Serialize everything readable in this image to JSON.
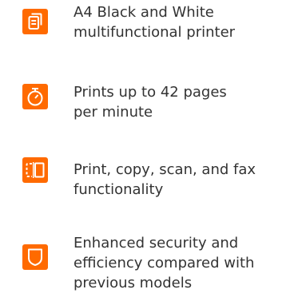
{
  "theme": {
    "accent": "#ff6a00",
    "text": "#333333",
    "background": "#ffffff"
  },
  "features": [
    {
      "icon": "document-copy-icon",
      "lines": [
        "A4 Black and White",
        "multifunctional printer"
      ]
    },
    {
      "icon": "stopwatch-icon",
      "lines": [
        "Prints up to 42 pages",
        "per minute"
      ]
    },
    {
      "icon": "copy-scan-icon",
      "lines": [
        "Print, copy, scan, and fax",
        "functionality"
      ]
    },
    {
      "icon": "shield-icon",
      "lines": [
        "Enhanced security and",
        "efficiency compared with",
        "previous models"
      ]
    }
  ]
}
